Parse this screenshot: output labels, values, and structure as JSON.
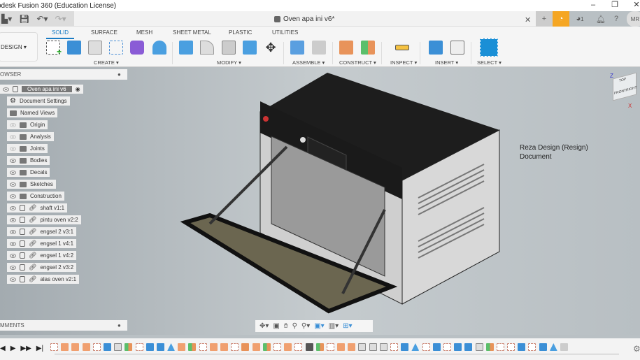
{
  "app": {
    "title": "odesk Fusion 360 (Education License)",
    "doc_tab": "Oven apa ini v6*",
    "jobs_count": "1",
    "user_initials": "MR"
  },
  "ribbon": {
    "workspace": "DESIGN ▾",
    "tabs": [
      "SOLID",
      "SURFACE",
      "MESH",
      "SHEET METAL",
      "PLASTIC",
      "UTILITIES"
    ],
    "active_tab": "SOLID",
    "groups": [
      "CREATE ▾",
      "MODIFY ▾",
      "ASSEMBLE ▾",
      "CONSTRUCT ▾",
      "INSPECT ▾",
      "INSERT ▾",
      "SELECT ▾"
    ]
  },
  "browser": {
    "title": "OWSER",
    "root": "Oven apa ini v6",
    "folders": [
      {
        "label": "Document Settings",
        "type": "gear"
      },
      {
        "label": "Named Views",
        "type": "folder"
      },
      {
        "label": "Origin",
        "type": "folder",
        "hidden": true
      },
      {
        "label": "Analysis",
        "type": "folder",
        "hidden": true
      },
      {
        "label": "Joints",
        "type": "folder",
        "hidden": true
      },
      {
        "label": "Bodies",
        "type": "folder"
      },
      {
        "label": "Decals",
        "type": "folder"
      },
      {
        "label": "Sketches",
        "type": "folder"
      },
      {
        "label": "Construction",
        "type": "folder"
      }
    ],
    "components": [
      "shaft v1:1",
      "pintu oven v2:2",
      "engsel 2 v3:1",
      "engsel 1 v4:1",
      "engsel 1 v4:2",
      "engsel 2 v3:2",
      "alas oven v2:1"
    ]
  },
  "viewcube": {
    "top": "TOP",
    "front": "FRONT",
    "right": "RIGHT",
    "z": "Z",
    "x": "X"
  },
  "viewport_note": {
    "line1": "Reza Design (Resign)",
    "line2": "Document"
  },
  "comments": {
    "title": "MMENTS"
  },
  "timeline": {
    "icons": "sooosbdgsbbtogsoosfogsosxgsoodddsbtsbsbbdgssbsbtp"
  },
  "colors": {
    "accent": "#1a7cc4",
    "orange": "#f5a623"
  }
}
